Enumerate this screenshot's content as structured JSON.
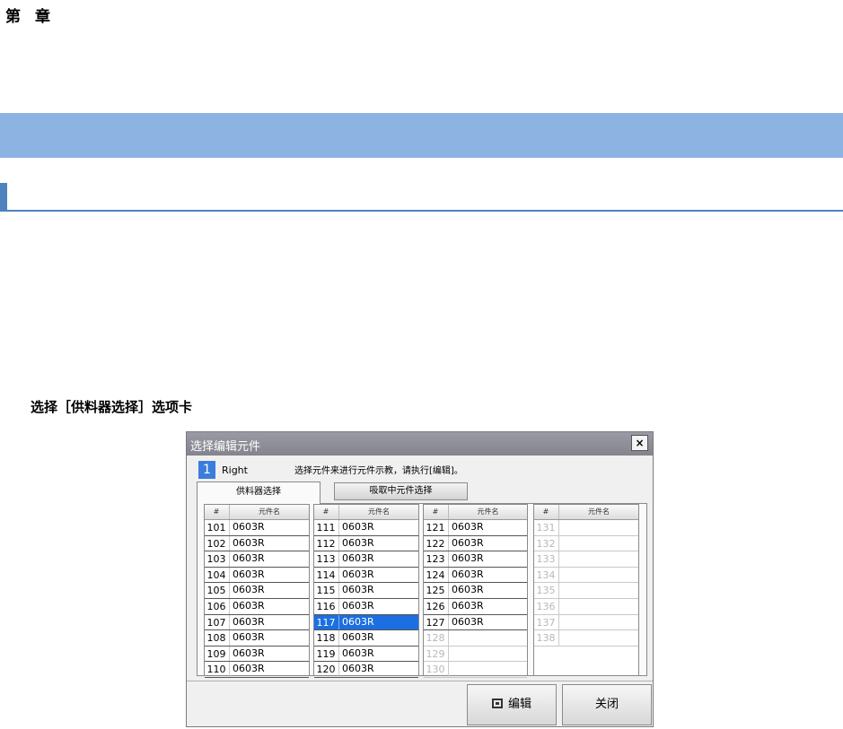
{
  "doc": {
    "chapter_char1": "第",
    "chapter_char2": "章",
    "step_text": "选择［供料器选择］选项卡"
  },
  "dialog": {
    "title": "选择编辑元件",
    "close_symbol": "×",
    "head_number": "1",
    "head_label": "Right",
    "message": "选择元件来进行元件示教，请执行[编辑]。",
    "tabs": [
      "供料器选择",
      "吸取中元件选择"
    ],
    "column_headers": {
      "num": "#",
      "name": "元件名"
    },
    "columns": [
      {
        "rows": [
          {
            "num": "101",
            "name": "0603R"
          },
          {
            "num": "102",
            "name": "0603R"
          },
          {
            "num": "103",
            "name": "0603R"
          },
          {
            "num": "104",
            "name": "0603R"
          },
          {
            "num": "105",
            "name": "0603R"
          },
          {
            "num": "106",
            "name": "0603R"
          },
          {
            "num": "107",
            "name": "0603R"
          },
          {
            "num": "108",
            "name": "0603R"
          },
          {
            "num": "109",
            "name": "0603R"
          },
          {
            "num": "110",
            "name": "0603R"
          }
        ]
      },
      {
        "rows": [
          {
            "num": "111",
            "name": "0603R"
          },
          {
            "num": "112",
            "name": "0603R"
          },
          {
            "num": "113",
            "name": "0603R"
          },
          {
            "num": "114",
            "name": "0603R"
          },
          {
            "num": "115",
            "name": "0603R"
          },
          {
            "num": "116",
            "name": "0603R"
          },
          {
            "num": "117",
            "name": "0603R",
            "selected": true
          },
          {
            "num": "118",
            "name": "0603R"
          },
          {
            "num": "119",
            "name": "0603R"
          },
          {
            "num": "120",
            "name": "0603R"
          }
        ]
      },
      {
        "rows": [
          {
            "num": "121",
            "name": "0603R"
          },
          {
            "num": "122",
            "name": "0603R"
          },
          {
            "num": "123",
            "name": "0603R"
          },
          {
            "num": "124",
            "name": "0603R"
          },
          {
            "num": "125",
            "name": "0603R"
          },
          {
            "num": "126",
            "name": "0603R"
          },
          {
            "num": "127",
            "name": "0603R"
          },
          {
            "num": "128",
            "name": ""
          },
          {
            "num": "129",
            "name": ""
          },
          {
            "num": "130",
            "name": ""
          }
        ]
      },
      {
        "rows": [
          {
            "num": "131",
            "name": ""
          },
          {
            "num": "132",
            "name": ""
          },
          {
            "num": "133",
            "name": ""
          },
          {
            "num": "134",
            "name": ""
          },
          {
            "num": "135",
            "name": ""
          },
          {
            "num": "136",
            "name": ""
          },
          {
            "num": "137",
            "name": ""
          },
          {
            "num": "138",
            "name": ""
          }
        ]
      }
    ],
    "buttons": {
      "edit": "编辑",
      "close": "关闭"
    },
    "colors": {
      "selected_row": "#1c6fe0",
      "titlebar": "#8e8e98",
      "accent_number": "#3b7ddd"
    }
  }
}
